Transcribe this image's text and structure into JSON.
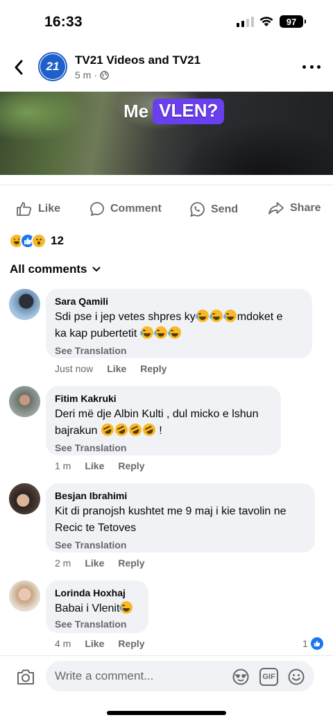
{
  "status_bar": {
    "time": "16:33",
    "battery": "97"
  },
  "post": {
    "author": "TV21 Videos and TV21",
    "avatar_text": "21",
    "time": "5 m",
    "separator": "·"
  },
  "video": {
    "caption_plain": "Me",
    "caption_highlight": "VLEN?"
  },
  "actions": {
    "like": "Like",
    "comment": "Comment",
    "send": "Send",
    "share": "Share"
  },
  "reactions": {
    "count": "12",
    "types": [
      "haha",
      "like",
      "wow"
    ]
  },
  "comments_filter": {
    "label": "All comments"
  },
  "comments": [
    {
      "name": "Sara Qamili",
      "text_parts": [
        "Sdi pse i jep vetes shpres ky",
        "mdoket e",
        "ka kap pubertetit"
      ],
      "translation": "See Translation",
      "time": "Just now",
      "like": "Like",
      "reply": "Reply"
    },
    {
      "name": "Fitim Kakruki",
      "text_parts": [
        "Deri më dje Albin Kulti , dul micko e lshun",
        "bajrakun",
        "!"
      ],
      "translation": "See Translation",
      "time": "1 m",
      "like": "Like",
      "reply": "Reply"
    },
    {
      "name": "Besjan Ibrahimi",
      "text_parts": [
        "Kit di pranojsh kushtet me 9 maj  i kie tavolin ne",
        "Recic te Tetoves"
      ],
      "translation": "See Translation",
      "time": "2 m",
      "like": "Like",
      "reply": "Reply"
    },
    {
      "name": "Lorinda Hoxhaj",
      "text_parts": [
        "Babai i Vlenit"
      ],
      "translation": "See Translation",
      "time": "4 m",
      "like": "Like",
      "reply": "Reply",
      "like_count": "1"
    }
  ],
  "composer": {
    "placeholder": "Write a comment...",
    "gif": "GIF"
  },
  "colors": {
    "brand_blue": "#1877f2",
    "secondary_text": "#65676b",
    "bubble": "#f0f2f5",
    "video_highlight": "#6a3ff0"
  }
}
